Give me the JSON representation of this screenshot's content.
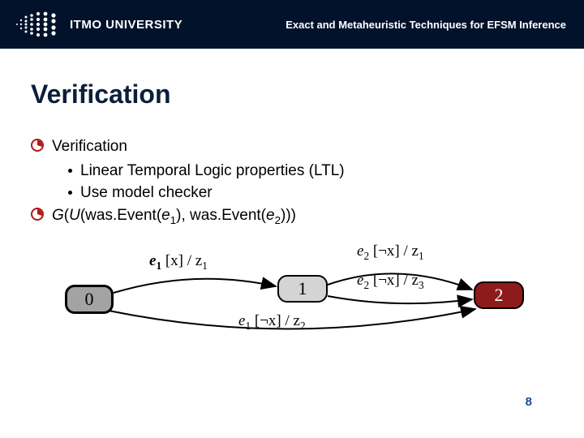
{
  "header": {
    "university": "ITMO UNIVERSITY",
    "title": "Exact and Metaheuristic Techniques for EFSM Inference"
  },
  "slide": {
    "heading": "Verification",
    "bullets": {
      "b1": "Verification",
      "b1a": "Linear Temporal Logic properties (LTL)",
      "b1b": "Use model checker",
      "b2_G": "G",
      "b2_U": "U",
      "b2_open": "(",
      "b2_was1": "(was.Event(",
      "b2_e": "e",
      "b2_sub1": "1",
      "b2_mid": "), was.Event(",
      "b2_sub2": "2",
      "b2_close": ")))"
    },
    "diagram": {
      "n0": "0",
      "n1": "1",
      "n2": "2",
      "edge01_e": "e",
      "edge01_sub": "1",
      "edge01_rest": " [x] / z",
      "edge01_zsub": "1",
      "edge12a_e": "e",
      "edge12a_sub": "2",
      "edge12a_rest": " [¬x] / z",
      "edge12a_zsub": "1",
      "edge12b_e": "e",
      "edge12b_sub": "2",
      "edge12b_rest": " [¬x] / z",
      "edge12b_zsub": "3",
      "edge02_e": "e",
      "edge02_sub": "1",
      "edge02_rest": " [¬x] / z",
      "edge02_zsub": "2"
    },
    "page_number": "8"
  }
}
